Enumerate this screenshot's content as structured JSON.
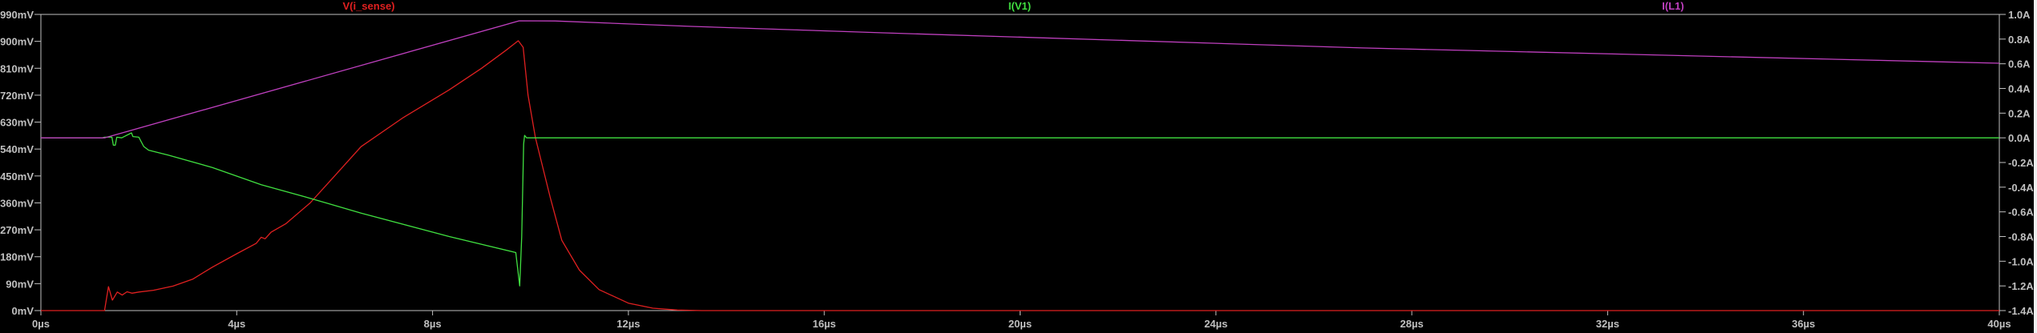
{
  "chart_data": {
    "type": "line",
    "title": "",
    "xlabel": "",
    "ylabel_left": "",
    "ylabel_right": "",
    "xlim": [
      0,
      40
    ],
    "ylim_left": [
      0,
      990
    ],
    "ylim_right": [
      -1.4,
      1.0
    ],
    "x_ticks": [
      0,
      4,
      8,
      12,
      16,
      20,
      24,
      28,
      32,
      36,
      40
    ],
    "x_tick_labels": [
      "0µs",
      "4µs",
      "8µs",
      "12µs",
      "16µs",
      "20µs",
      "24µs",
      "28µs",
      "32µs",
      "36µs",
      "40µs"
    ],
    "left_ticks": [
      0,
      90,
      180,
      270,
      360,
      450,
      540,
      630,
      720,
      810,
      900,
      990
    ],
    "left_tick_labels": [
      "0mV",
      "90mV",
      "180mV",
      "270mV",
      "360mV",
      "450mV",
      "540mV",
      "630mV",
      "720mV",
      "810mV",
      "900mV",
      "990mV"
    ],
    "right_ticks": [
      1.0,
      0.8,
      0.6,
      0.4,
      0.2,
      0.0,
      -0.2,
      -0.4,
      -0.6,
      -0.8,
      -1.0,
      -1.2,
      -1.4
    ],
    "right_tick_labels": [
      "1.0A",
      "0.8A",
      "0.6A",
      "0.4A",
      "0.2A",
      "0.0A",
      "-0.2A",
      "-0.4A",
      "-0.6A",
      "-0.8A",
      "-1.0A",
      "-1.2A",
      "-1.4A"
    ],
    "grid": false,
    "series": [
      {
        "name": "V(i_sense)",
        "axis": "left",
        "unit": "mV",
        "color": "#e02020",
        "points": [
          [
            0,
            0
          ],
          [
            1.3,
            0
          ],
          [
            1.38,
            80
          ],
          [
            1.46,
            35
          ],
          [
            1.56,
            62
          ],
          [
            1.66,
            52
          ],
          [
            1.76,
            63
          ],
          [
            1.86,
            58
          ],
          [
            2.0,
            62
          ],
          [
            2.3,
            68
          ],
          [
            2.7,
            82
          ],
          [
            3.1,
            105
          ],
          [
            3.5,
            145
          ],
          [
            4.0,
            190
          ],
          [
            4.4,
            225
          ],
          [
            4.5,
            245
          ],
          [
            4.58,
            240
          ],
          [
            4.7,
            262
          ],
          [
            5.0,
            290
          ],
          [
            5.5,
            360
          ],
          [
            6.0,
            450
          ],
          [
            6.54,
            548
          ],
          [
            7.4,
            645
          ],
          [
            8.34,
            738
          ],
          [
            9.0,
            810
          ],
          [
            9.5,
            870
          ],
          [
            9.75,
            902
          ],
          [
            9.85,
            880
          ],
          [
            9.95,
            720
          ],
          [
            10.1,
            578
          ],
          [
            10.4,
            380
          ],
          [
            10.64,
            235
          ],
          [
            11.0,
            135
          ],
          [
            11.4,
            70
          ],
          [
            12.0,
            25
          ],
          [
            12.5,
            8
          ],
          [
            13.0,
            2
          ],
          [
            13.5,
            0
          ],
          [
            40,
            0
          ]
        ]
      },
      {
        "name": "I(V1)",
        "axis": "right",
        "unit": "A",
        "color": "#40e040",
        "points": [
          [
            0,
            0
          ],
          [
            1.25,
            0
          ],
          [
            1.3,
            0.005
          ],
          [
            1.45,
            0.005
          ],
          [
            1.48,
            -0.06
          ],
          [
            1.52,
            -0.06
          ],
          [
            1.55,
            0.005
          ],
          [
            1.65,
            0.0
          ],
          [
            1.85,
            0.04
          ],
          [
            1.88,
            0.01
          ],
          [
            2.0,
            0.005
          ],
          [
            2.1,
            -0.07
          ],
          [
            2.2,
            -0.1
          ],
          [
            2.6,
            -0.14
          ],
          [
            3.5,
            -0.24
          ],
          [
            4.0,
            -0.31
          ],
          [
            4.5,
            -0.38
          ],
          [
            5.5,
            -0.49
          ],
          [
            6.54,
            -0.61
          ],
          [
            8.34,
            -0.8
          ],
          [
            9.7,
            -0.93
          ],
          [
            9.78,
            -1.2
          ],
          [
            9.82,
            -0.8
          ],
          [
            9.86,
            -0.05
          ],
          [
            9.88,
            0.02
          ],
          [
            9.92,
            0.0
          ],
          [
            40,
            0
          ]
        ]
      },
      {
        "name": "I(L1)",
        "axis": "right",
        "unit": "A",
        "color": "#c040c0",
        "points": [
          [
            0,
            0
          ],
          [
            1.3,
            0
          ],
          [
            9.77,
            0.948
          ],
          [
            10.5,
            0.947
          ],
          [
            13.3,
            0.903
          ],
          [
            17.2,
            0.851
          ],
          [
            27,
            0.728
          ],
          [
            40,
            0.604
          ]
        ]
      }
    ]
  },
  "legend": {
    "v_isense": "V(i_sense)",
    "i_v1": "I(V1)",
    "i_l1": "I(L1)"
  },
  "colors": {
    "frame": "#c0c0c0",
    "label": "#c0c0c0",
    "background": "#000000"
  }
}
